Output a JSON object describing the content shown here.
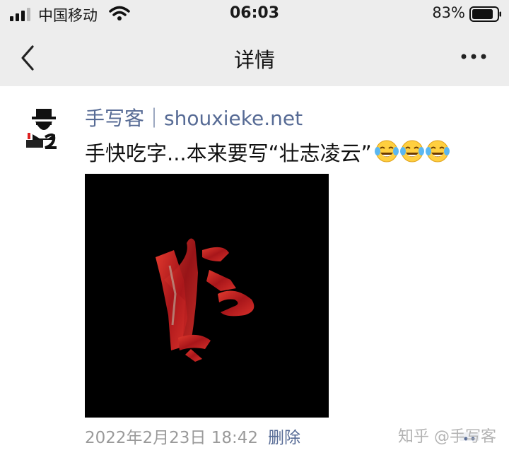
{
  "status_bar": {
    "carrier": "中国移动",
    "time": "06:03",
    "battery": "83%"
  },
  "nav": {
    "title": "详情",
    "back_icon": "chevron-left-icon",
    "more_icon": "more-icon"
  },
  "post": {
    "author": "手写客｜shouxieke.net",
    "text": "手快吃字...本来要写“壮志凌云”",
    "emoji": [
      "tears-of-joy-emoji",
      "tears-of-joy-emoji",
      "tears-of-joy-emoji"
    ],
    "timestamp": "2022年2月23日 18:42",
    "delete_label": "删除"
  },
  "watermark": "知乎 @手写客",
  "colors": {
    "bar_bg": "#ededed",
    "link": "#576b95",
    "meta": "#9a9a9a"
  }
}
